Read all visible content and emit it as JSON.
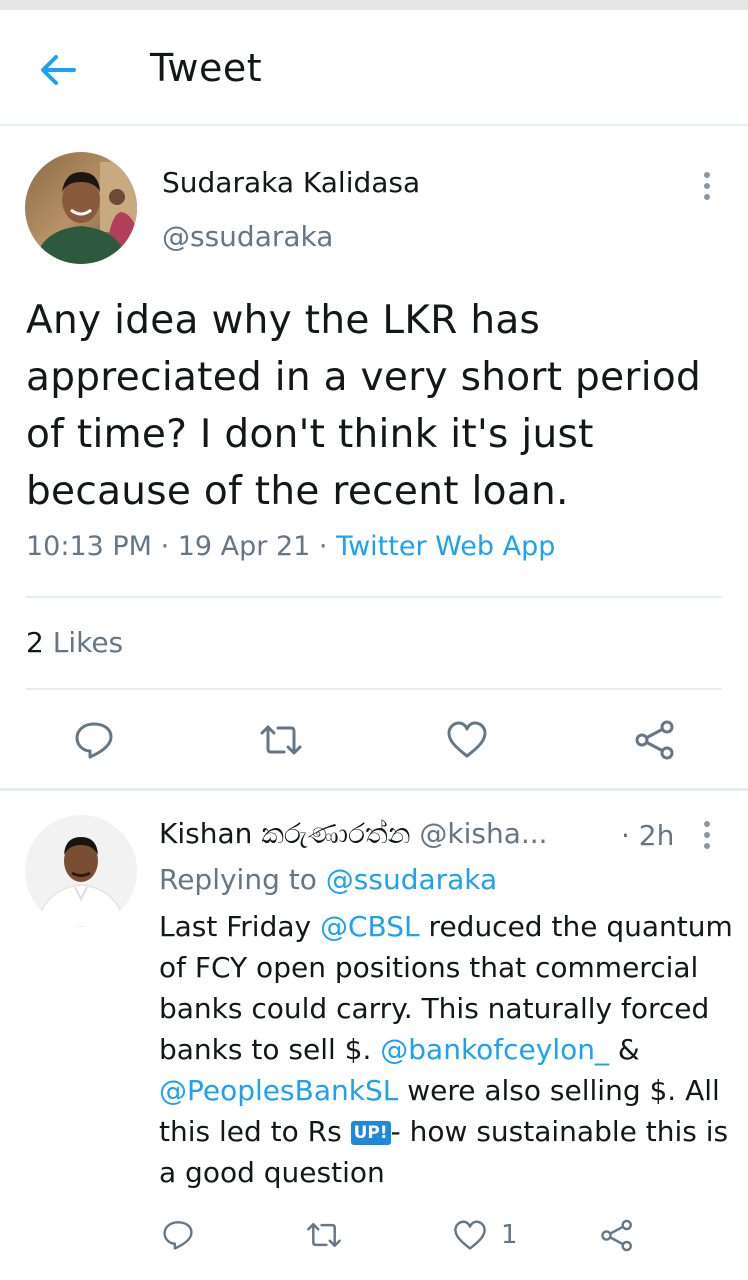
{
  "header": {
    "title": "Tweet",
    "back_icon": "arrow-left-icon",
    "accent_color": "#1da1f2"
  },
  "tweet": {
    "author_name": "Sudaraka Kalidasa",
    "author_handle": "@ssudaraka",
    "text": "Any idea why the LKR has appreciated in a very short period of time? I don't think it's just because of the recent loan.",
    "time": "10:13 PM",
    "sep1": " · ",
    "date": "19 Apr 21",
    "sep2": " · ",
    "source": "Twitter Web App",
    "likes_count": "2",
    "likes_label": " Likes",
    "actions": [
      "reply-icon",
      "retweet-icon",
      "like-icon",
      "share-icon"
    ]
  },
  "reply": {
    "author_name": "Kishan කරුණාරත්න",
    "author_handle": "@kisha...",
    "time": "· 2h",
    "replying_prefix": "Replying to ",
    "replying_to": "@ssudaraka",
    "text_parts": {
      "p1": "Last Friday ",
      "m1": "@CBSL",
      "p2": " reduced the quantum of FCY open positions that commercial banks could carry. This naturally forced banks to sell $. ",
      "m2": "@bankofceylon_",
      "p3": " & ",
      "m3": "@PeoplesBankSL",
      "p4": " were also selling $. All this led to Rs ",
      "badge": "UP!",
      "p5": "- how sustainable this is a good question"
    },
    "like_count": "1"
  }
}
